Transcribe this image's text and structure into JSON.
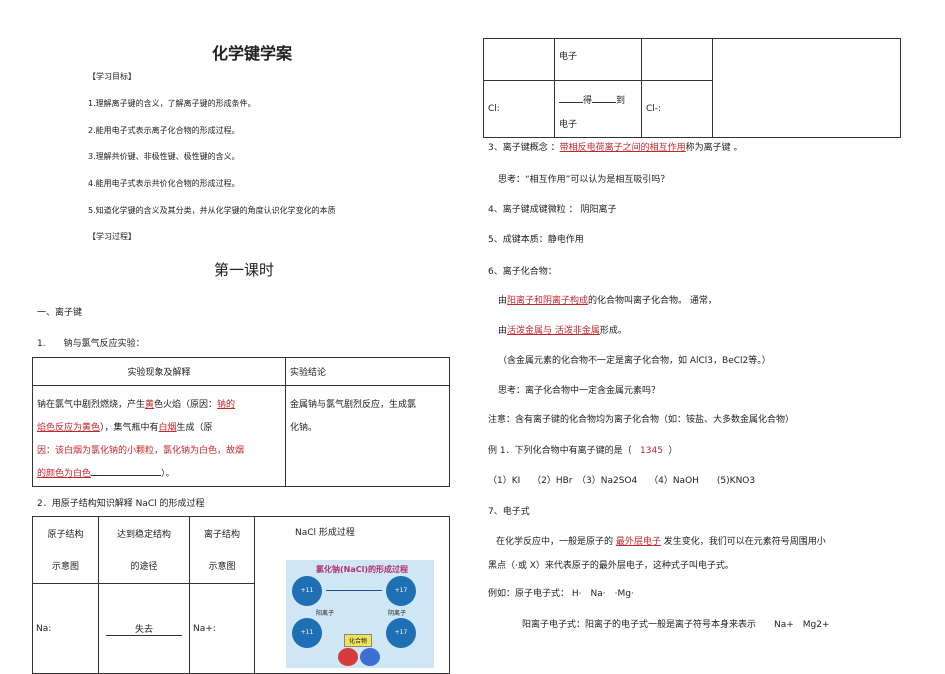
{
  "left": {
    "title": "化学键学案",
    "objectives_heading": "【学习目标】",
    "objectives": [
      "1.理解离子键的含义，了解离子键的形成条件。",
      "2.能用电子式表示离子化合物的形成过程。",
      "3.理解共价键、非极性键、极性键的含义。",
      "4.能用电子式表示共价化合物的形成过程。",
      "5.知道化学键的含义及其分类，并从化学键的角度认识化学变化的本质"
    ],
    "process_heading": "【学习过程】",
    "lesson_title": "第一课时",
    "section1": "一、离子键",
    "item1": "1.　　钠与氯气反应实验：",
    "table1": {
      "h1": "实验现象及解释",
      "h2": "实验结论",
      "c1_l1a": "钠在氯气中剧烈燃烧，产生",
      "c1_l1b": "黄",
      "c1_l1c": "色火焰（原因：",
      "c1_l1d": "钠的",
      "c1_l2a": "焰色反应为黄色",
      "c1_l2b": "），集气瓶中有",
      "c1_l2c": "白烟",
      "c1_l2d": "生成（原",
      "c1_l3": "因：该白烟为氯化钠的小颗粒，氯化钠为白色，故烟",
      "c1_l4a": "的颜色为白色",
      "c1_l4b": "）。",
      "c2_l1": "金属钠与氯气剧烈反应，生成氯",
      "c2_l2": "化钠。"
    },
    "item2": "2．用原子结构知识解释 NaCl 的形成过程",
    "table2": {
      "h1a": "原子结构",
      "h1b": "示意图",
      "h2a": "达到稳定结构",
      "h2b": "的途径",
      "h3a": "离子结构",
      "h3b": "示意图",
      "h4": "NaCl 形成过程",
      "r1c1": "Na:",
      "r1c2": "失去",
      "r1c3": "Na+:"
    },
    "diagram": {
      "title": "氯化钠(NaCl)的形成过程",
      "na": "+11",
      "cl": "+17",
      "label1": "阳离子",
      "label2": "阴离子",
      "compound": "化合物"
    }
  },
  "right": {
    "top_table": {
      "r1c2": "电子",
      "r2c1": "Cl:",
      "r2c2a": "得",
      "r2c2b": "到",
      "r2c2c": "电子",
      "r2c3": "Cl-:"
    },
    "p3a": "3、离子键概念 ：",
    "p3b": "带相反电荷离子之间的相互作用",
    "p3c": "称为离子键 。",
    "think1": "思考：“相互作用”可以认为是相互吸引吗？",
    "p4": "4、离子键成键微粒 ： 阴阳离子",
    "p5": "5、成键本质：静电作用",
    "p6": "6、离子化合物：",
    "p6a1": "由",
    "p6a2": "阳离子和阴离子构成",
    "p6a3": "的化合物叫离子化合物。 通常，",
    "p6b1": "由",
    "p6b2": "活泼金属与 活泼非金属",
    "p6b3": "形成。",
    "note1": "（含金属元素的化合物不一定是离子化合物，如 AlCl3，BeCl2等。）",
    "think2": "思考：离子化合物中一定含金属元素吗？",
    "note2": "注意：含有离子键的化合物均为离子化合物（如：铵盐、大多数金属化合物）",
    "ex1a": "例 1．下列化合物中有离子键的是（",
    "ex1b": "1345",
    "ex1c": "）",
    "options": "（1）KI　 （2）HBr　（3）Na2SO4　 （4）NaOH　　(5)KNO3",
    "p7": "7、电子式",
    "p7a1": "在化学反应中，一般是原子的",
    "p7a2": "最外层电子",
    "p7a3": "发生变化，我们可以在元素符号周围用小",
    "p7b": "黑点（·或 X）来代表原子的最外层电子，这种式子叫电子式。",
    "ex_atoms": "例如：原子电子式： H·　Na·　·Mg·",
    "ex_ions": "阳离子电子式：阳离子的电子式一般是离子符号本身来表示　　Na+　Mg2+"
  }
}
